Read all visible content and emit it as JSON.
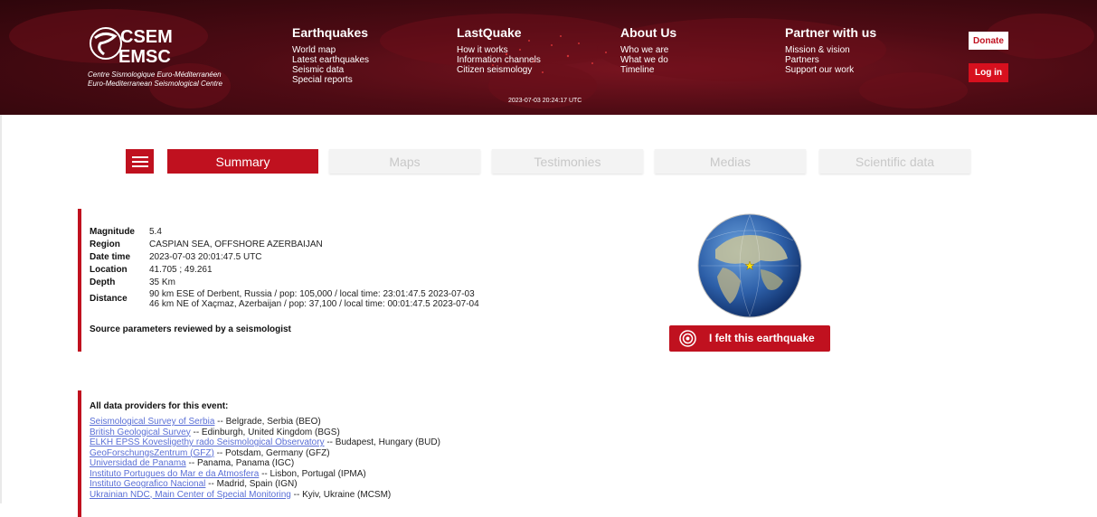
{
  "header": {
    "logo": {
      "line1": "CSEM",
      "line2": "EMSC",
      "subtitle_fr": "Centre Sismologique Euro-Méditerranéen",
      "subtitle_en": "Euro-Mediterranean Seismological Centre"
    },
    "nav": [
      {
        "title": "Earthquakes",
        "links": [
          "World map",
          "Latest earthquakes",
          "Seismic data",
          "Special reports"
        ]
      },
      {
        "title": "LastQuake",
        "links": [
          "How it works",
          "Information channels",
          "Citizen seismology"
        ]
      },
      {
        "title": "About Us",
        "links": [
          "Who we are",
          "What we do",
          "Timeline"
        ]
      },
      {
        "title": "Partner with us",
        "links": [
          "Mission & vision",
          "Partners",
          "Support our work"
        ]
      }
    ],
    "timestamp": "2023-07-03 20:24:17 UTC",
    "donate_label": "Donate",
    "login_label": "Log in",
    "colors": {
      "header_bg": "#4e0b14",
      "accent": "#c0111f"
    }
  },
  "tabs": [
    {
      "label": "Summary",
      "active": true
    },
    {
      "label": "Maps",
      "active": false
    },
    {
      "label": "Testimonies",
      "active": false
    },
    {
      "label": "Medias",
      "active": false
    },
    {
      "label": "Scientific data",
      "active": false
    }
  ],
  "summary": {
    "rows": [
      {
        "key": "Magnitude",
        "value": "5.4"
      },
      {
        "key": "Region",
        "value": "CASPIAN SEA, OFFSHORE AZERBAIJAN"
      },
      {
        "key": "Date time",
        "value": "2023-07-03 20:01:47.5 UTC"
      },
      {
        "key": "Location",
        "value": "41.705 ; 49.261"
      },
      {
        "key": "Depth",
        "value": "35 Km"
      }
    ],
    "distance_key": "Distance",
    "distance_lines": [
      "90 km ESE of Derbent, Russia / pop: 105,000 / local time: 23:01:47.5 2023-07-03",
      "46 km NE of Xaçmaz, Azerbaijan / pop: 37,100 / local time: 00:01:47.5 2023-07-04"
    ],
    "reviewed_note": "Source parameters reviewed by a seismologist"
  },
  "felt_button_label": "I felt this earthquake",
  "providers": {
    "title": "All data providers for this event:",
    "items": [
      {
        "name": "Seismological Survey of Serbia",
        "detail": " -- Belgrade, Serbia (BEO)"
      },
      {
        "name": "British Geological Survey",
        "detail": " -- Edinburgh, United Kingdom (BGS)"
      },
      {
        "name": "ELKH EPSS Kovesligethy rado Seismological Observatory",
        "detail": " -- Budapest, Hungary (BUD)"
      },
      {
        "name": "GeoForschungsZentrum (GFZ)",
        "detail": " -- Potsdam, Germany (GFZ)"
      },
      {
        "name": "Universidad de Panama",
        "detail": " -- Panama, Panama (IGC)"
      },
      {
        "name": "Instituto Portugues do Mar e da Atmosfera",
        "detail": " -- Lisbon, Portugal (IPMA)"
      },
      {
        "name": "Instituto Geografico Nacional",
        "detail": " -- Madrid, Spain (IGN)"
      },
      {
        "name": "Ukrainian NDC, Main Center of Special Monitoring",
        "detail": " -- Kyiv, Ukraine (MCSM)"
      }
    ]
  }
}
